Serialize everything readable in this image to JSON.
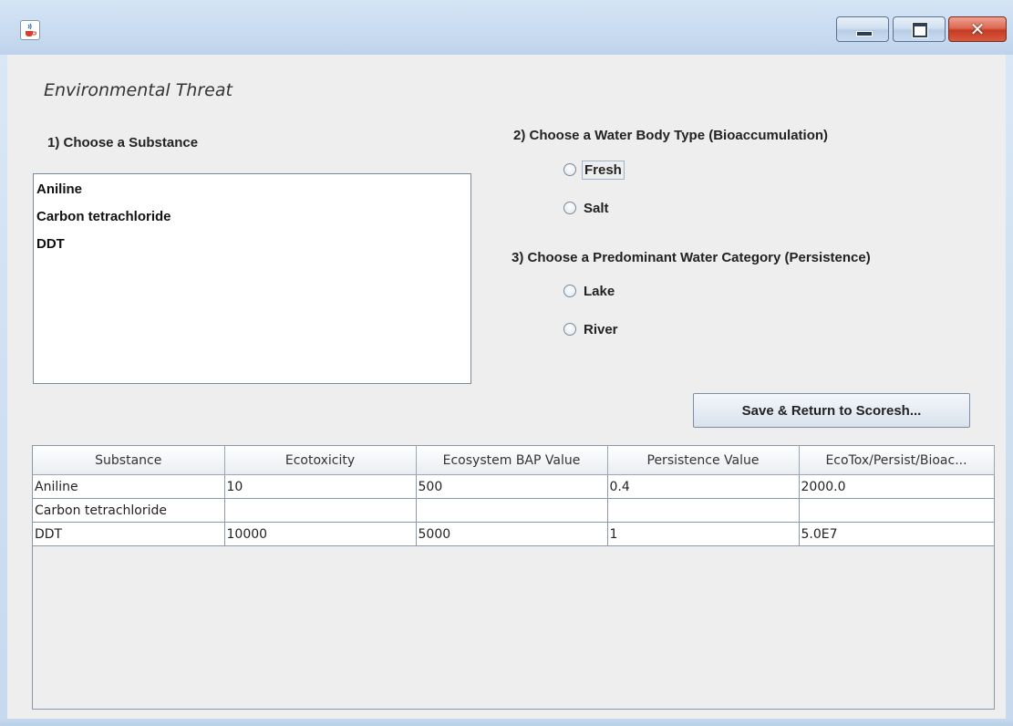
{
  "window": {
    "title": "",
    "app_icon": "java-cup-icon",
    "controls": {
      "minimize_icon": "minimize-icon",
      "maximize_icon": "maximize-icon",
      "close_glyph": "✕"
    }
  },
  "heading": "Environmental Threat",
  "substance": {
    "label": "1) Choose a Substance",
    "items": [
      "Aniline",
      "Carbon tetrachloride",
      "DDT"
    ]
  },
  "water_body": {
    "label": "2) Choose a Water Body Type (Bioaccumulation)",
    "options": [
      "Fresh",
      "Salt"
    ],
    "focused": "Fresh",
    "selected": null
  },
  "water_category": {
    "label": "3) Choose a Predominant Water Category (Persistence)",
    "options": [
      "Lake",
      "River"
    ],
    "selected": null
  },
  "save_button": "Save & Return to Scoresh...",
  "table": {
    "columns": [
      "Substance",
      "Ecotoxicity",
      "Ecosystem BAP Value",
      "Persistence Value",
      "EcoTox/Persist/Bioac..."
    ],
    "rows": [
      [
        "Aniline",
        "10",
        "500",
        "0.4",
        "2000.0"
      ],
      [
        "Carbon tetrachloride",
        "",
        "",
        "",
        ""
      ],
      [
        "DDT",
        "10000",
        "5000",
        "1",
        "5.0E7"
      ]
    ]
  },
  "colors": {
    "titlebar": "#c8dbf0",
    "panel": "#eeeeee",
    "close_button": "#c43b22"
  }
}
